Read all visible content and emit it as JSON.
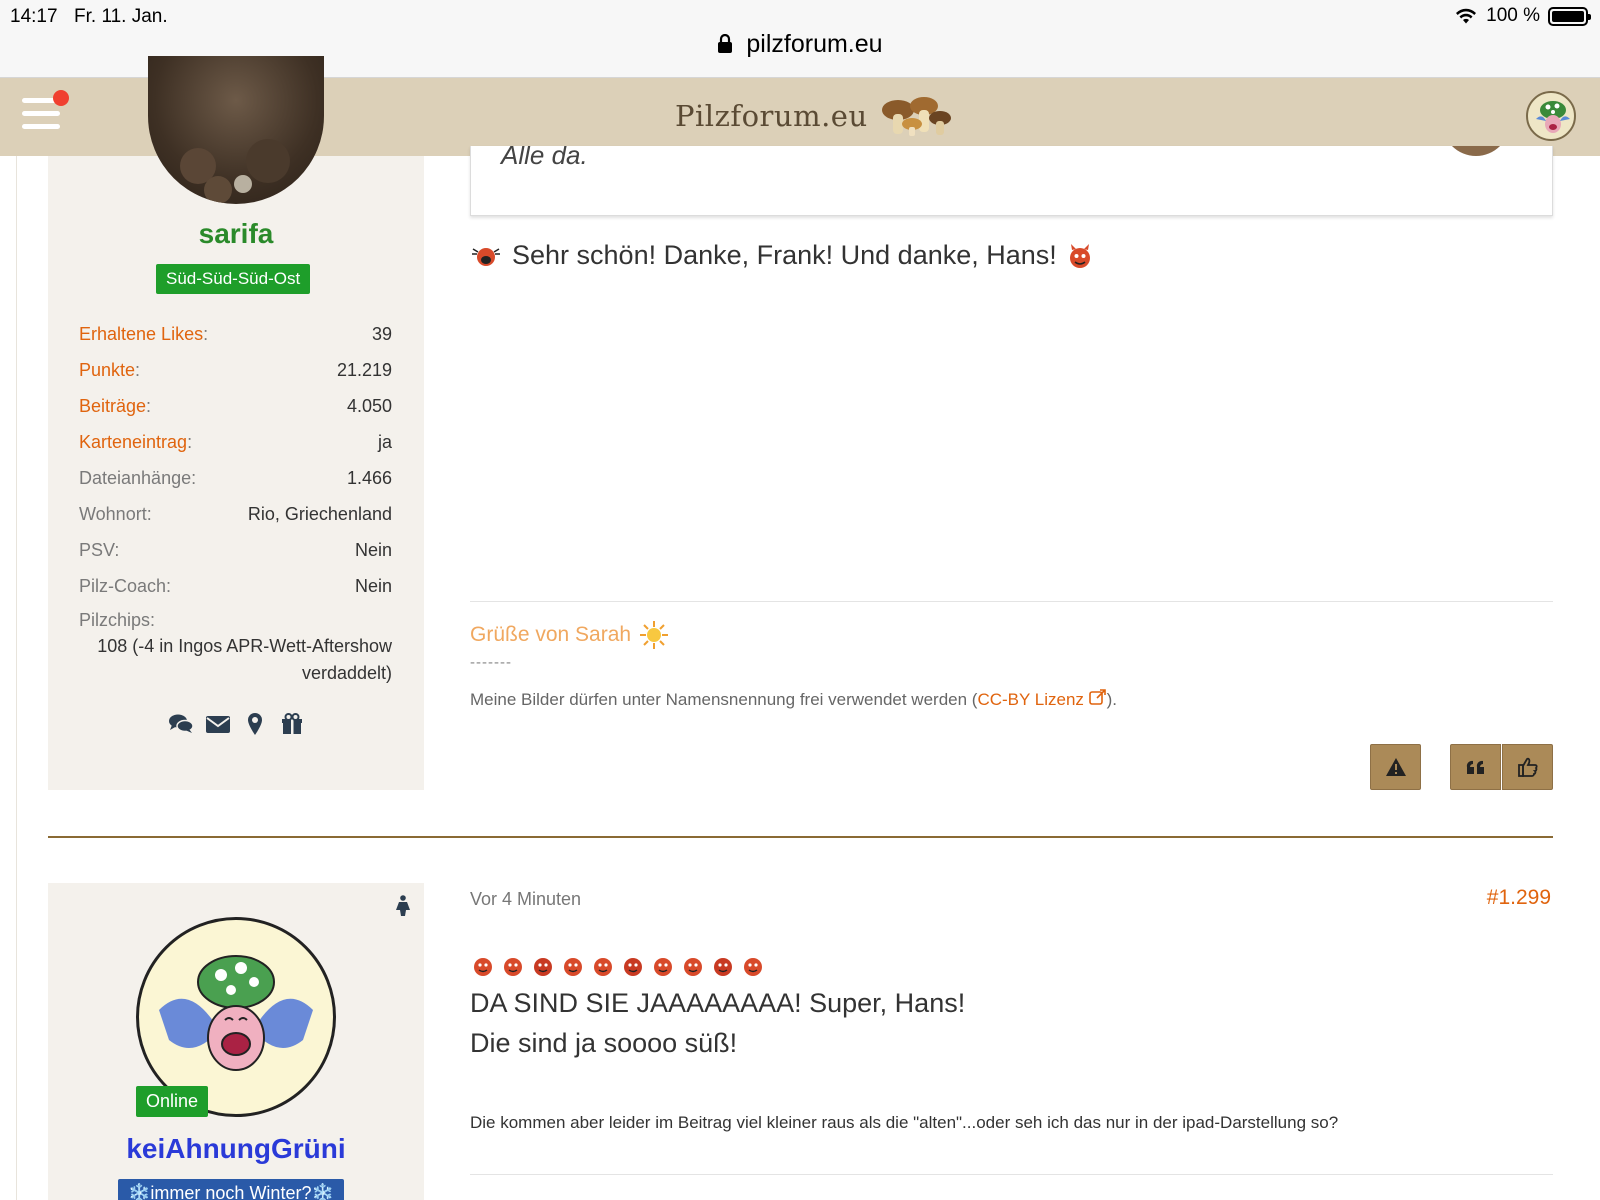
{
  "status_bar": {
    "time": "14:17",
    "date": "Fr. 11. Jan.",
    "battery_text": "100 %",
    "battery_level": 1.0
  },
  "url_bar": {
    "domain": "pilzforum.eu"
  },
  "header": {
    "logo_text": "Pilzforum.eu",
    "menu_notification": true,
    "colors": {
      "header_bg": "#dcd0b8",
      "accent": "#e0640e",
      "button": "#ab8a58"
    }
  },
  "post1": {
    "author": {
      "username": "sarifa",
      "rank": "Süd-Süd-Süd-Ost",
      "stats": [
        {
          "label": "Erhaltene Likes",
          "value": "39",
          "highlight": true
        },
        {
          "label": "Punkte",
          "value": "21.219",
          "highlight": true
        },
        {
          "label": "Beiträge",
          "value": "4.050",
          "highlight": true
        },
        {
          "label": "Karteneintrag",
          "value": "ja",
          "highlight": true
        },
        {
          "label": "Dateianhänge",
          "value": "1.466",
          "highlight": false
        },
        {
          "label": "Wohnort",
          "value": "Rio, Griechenland",
          "highlight": false
        },
        {
          "label": "PSV",
          "value": "Nein",
          "highlight": false
        },
        {
          "label": "Pilz-Coach",
          "value": "Nein",
          "highlight": false
        }
      ],
      "pilzchips_label": "Pilzchips:",
      "pilzchips_value": "108 (-4 in Ingos APR-Wett-Aftershow verdaddelt)",
      "icons": [
        "conversation-icon",
        "envelope-icon",
        "map-marker-icon",
        "gift-icon"
      ]
    },
    "quote_text": "Alle da.",
    "body_text": "Sehr schön! Danke, Frank! Und danke, Hans!",
    "signature": {
      "greeting": "Grüße von Sarah",
      "dashes": "-------",
      "license_prefix": "Meine Bilder dürfen unter Namensnennung frei verwendet werden (",
      "license_link": "CC-BY Lizenz",
      "license_suffix": ")."
    },
    "buttons": {
      "report": "warning-icon",
      "quote": "quote-icon",
      "like": "thumbs-up-icon"
    }
  },
  "post2": {
    "author": {
      "username": "keiAhnungGrüni",
      "online_badge": "Online",
      "rank": "❄️immer noch Winter?❄️"
    },
    "time": "Vor 4 Minuten",
    "number": "#1.299",
    "line1": "DA SIND SIE JAAAAAAAA! Super, Hans!",
    "line2": "Die sind ja soooo süß!",
    "small_text": "Die kommen aber leider im Beitrag viel kleiner raus als die \"alten\"...oder seh ich das nur in der ipad-Darstellung so?",
    "emoji_count": 10
  }
}
